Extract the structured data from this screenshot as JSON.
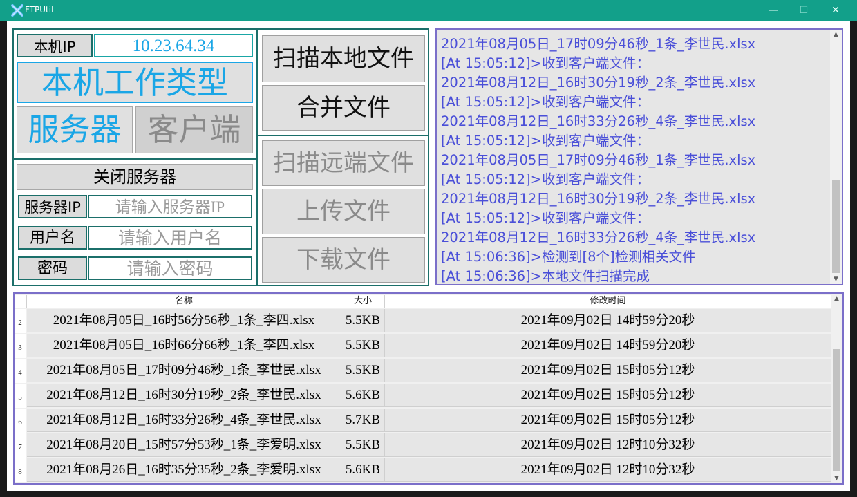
{
  "window": {
    "title": "FTPUtil",
    "minimize": "—",
    "maximize": "☐",
    "close": "✕"
  },
  "left_panel": {
    "ip_label": "本机IP",
    "ip_value": "10.23.64.34",
    "work_type_label": "本机工作类型",
    "server_label": "服务器",
    "client_label": "客户端"
  },
  "server_panel": {
    "close_server_button": "关闭服务器",
    "server_ip_label": "服务器IP",
    "server_ip_placeholder": "请输入服务器IP",
    "username_label": "用户名",
    "username_placeholder": "请输入用户名",
    "password_label": "密码",
    "password_placeholder": "请输入密码"
  },
  "actions": {
    "scan_local": "扫描本地文件",
    "merge_files": "合并文件",
    "scan_remote": "扫描远端文件",
    "upload": "上传文件",
    "download": "下载文件"
  },
  "log": [
    "2021年08月05日_17时09分46秒_1条_李世民.xlsx",
    "[At 15:05:12]>收到客户端文件：",
    "2021年08月12日_16时30分19秒_2条_李世民.xlsx",
    "[At 15:05:12]>收到客户端文件：",
    "2021年08月12日_16时33分26秒_4条_李世民.xlsx",
    "[At 15:05:12]>收到客户端文件：",
    "2021年08月05日_17时09分46秒_1条_李世民.xlsx",
    "[At 15:05:12]>收到客户端文件：",
    "2021年08月12日_16时30分19秒_2条_李世民.xlsx",
    "[At 15:05:12]>收到客户端文件：",
    "2021年08月12日_16时33分26秒_4条_李世民.xlsx",
    "[At 15:06:36]>检测到[8个]检测相关文件",
    "[At 15:06:36]>本地文件扫描完成"
  ],
  "table": {
    "columns": [
      "名称",
      "大小",
      "修改时间"
    ],
    "rows": [
      {
        "num": "2",
        "name": "2021年08月05日_16时56分56秒_1条_李四.xlsx",
        "size": "5.5KB",
        "time": "2021年09月02日 14时59分20秒"
      },
      {
        "num": "3",
        "name": "2021年08月05日_16时66分66秒_1条_李四.xlsx",
        "size": "5.5KB",
        "time": "2021年09月02日 14时59分20秒"
      },
      {
        "num": "4",
        "name": "2021年08月05日_17时09分46秒_1条_李世民.xlsx",
        "size": "5.5KB",
        "time": "2021年09月02日 15时05分12秒"
      },
      {
        "num": "5",
        "name": "2021年08月12日_16时30分19秒_2条_李世民.xlsx",
        "size": "5.6KB",
        "time": "2021年09月02日 15时05分12秒"
      },
      {
        "num": "6",
        "name": "2021年08月12日_16时33分26秒_4条_李世民.xlsx",
        "size": "5.7KB",
        "time": "2021年09月02日 15时05分12秒"
      },
      {
        "num": "7",
        "name": "2021年08月20日_15时57分53秒_1条_李爱明.xlsx",
        "size": "5.5KB",
        "time": "2021年09月02日 12时10分32秒"
      },
      {
        "num": "8",
        "name": "2021年08月26日_16时35分35秒_2条_李爱明.xlsx",
        "size": "5.6KB",
        "time": "2021年09月02日 12时10分32秒"
      }
    ]
  },
  "colors": {
    "titlebar": "#12a08a",
    "accent_cyan": "#1aa6e6",
    "log_text": "#4a4fd8",
    "panel_border": "#7b6fc9"
  }
}
